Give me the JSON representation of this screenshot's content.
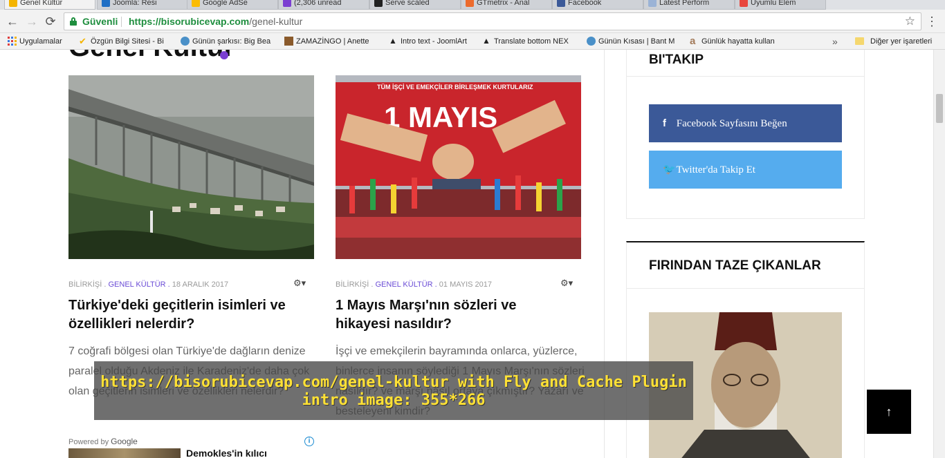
{
  "browser": {
    "tabs": [
      {
        "label": "Genel Kültür",
        "active": true
      },
      {
        "label": "Joomla: Resi",
        "active": false
      },
      {
        "label": "Google AdSe",
        "active": false
      },
      {
        "label": "(2,306 unread",
        "active": false
      },
      {
        "label": "Serve scaled",
        "active": false
      },
      {
        "label": "GTmetrix - Anal",
        "active": false
      },
      {
        "label": "Facebook",
        "active": false
      },
      {
        "label": "Latest Perform",
        "active": false
      },
      {
        "label": "Uyumlu Elem",
        "active": false
      }
    ],
    "security_label": "Güvenli",
    "url_host": "https://bisorubicevap.com",
    "url_path": "/genel-kultur",
    "bookmarks": [
      "Uygulamalar",
      "Özgün Bilgi Sitesi - Bi",
      "Günün şarkısı: Big Bea",
      "ZAMAZİNGO | Anette",
      "Intro text - JoomlArt",
      "Translate bottom NEX",
      "Günün Kısası | Bant M",
      "Günlük hayatta kullan"
    ],
    "bookmarks_overflow": "»",
    "other_bookmarks": "Diğer yer işaretleri"
  },
  "page": {
    "title": "Genel Kültür",
    "articles": [
      {
        "author": "BİLİRKİŞİ .",
        "category": "GENEL KÜLTÜR .",
        "date": "18 ARALIK 2017",
        "title": "Türkiye'deki geçitlerin isimleri ve özellikleri nelerdir?",
        "excerpt": "7 coğrafi bölgesi olan Türkiye'de dağların denize paralel olduğu Akdeniz ile Karadeniz'de daha çok olan geçitlerin isimleri ve özellikleri nelerdir?"
      },
      {
        "author": "BİLİRKİŞİ .",
        "category": "GENEL KÜLTÜR .",
        "date": "01 MAYIS 2017",
        "title": "1 Mayıs Marşı'nın sözleri ve hikayesi nasıldır?",
        "excerpt": "İşçi ve emekçilerin bayramında onlarca, yüzlerce, binlerce insanın söylediği 1 Mayıs Marşı'nın sözleri nasıldır? ve marşı nasıl ortaya çıkmıştır? Yazarı ve besteleyeni kimdir?"
      }
    ],
    "image2_banner_top": "TÜM İŞÇİ VE EMEKÇİLER BİRLEŞMEK KURTULARIZ",
    "image2_banner_main": "1 MAYIS",
    "powered_by": "Powered by",
    "powered_brand": "Google",
    "ad_info": "i",
    "ad_title": "Demokles'in kılıcı"
  },
  "sidebar": {
    "follow_title": "BI'TAKIP",
    "facebook_label": "Facebook Sayfasını Beğen",
    "twitter_label": "Twitter'da Takip Et",
    "fresh_title": "FIRINDAN TAZE ÇIKANLAR"
  },
  "overlay": {
    "line1": "https://bisorubicevap.com/genel-kultur with Fly and Cache Plugin",
    "line2": "intro image: 355*266"
  },
  "back_to_top": "↑",
  "colors": {
    "category": "#6a4bd6",
    "facebook": "#3b5998",
    "twitter": "#55acee",
    "overlay_text": "#ffe135",
    "secure_green": "#1e8e3e"
  }
}
